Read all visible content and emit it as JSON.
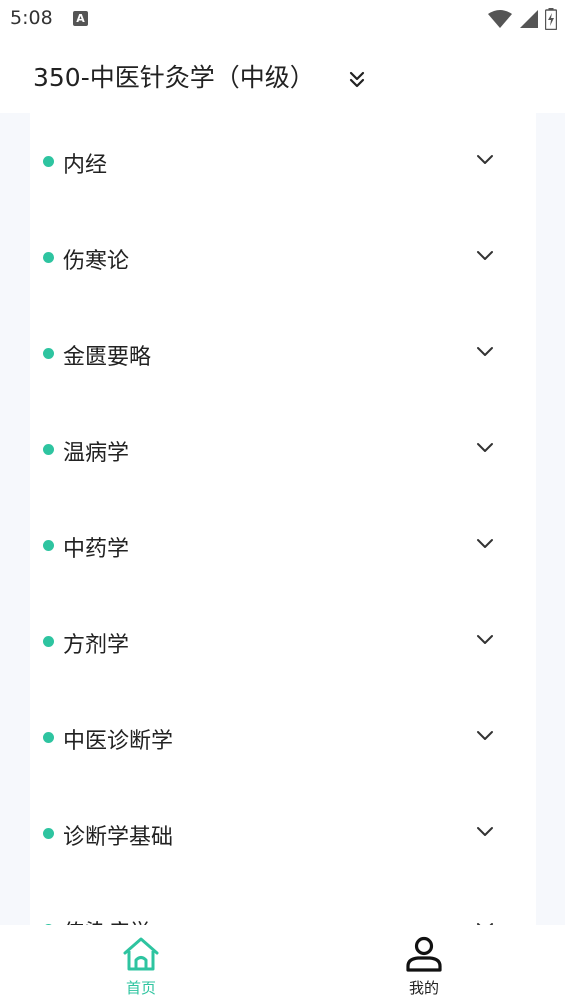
{
  "status_bar": {
    "time": "5:08",
    "notification_icon": "A"
  },
  "header": {
    "title": "350-中医针灸学（中级）",
    "toggle_icon": "double-chevron-down-icon"
  },
  "accent_color": "#2ec4a0",
  "subjects": [
    {
      "label": "内经"
    },
    {
      "label": "伤寒论"
    },
    {
      "label": "金匮要略"
    },
    {
      "label": "温病学"
    },
    {
      "label": "中药学"
    },
    {
      "label": "方剂学"
    },
    {
      "label": "中医诊断学"
    },
    {
      "label": "诊断学基础"
    },
    {
      "label": "传染病学"
    }
  ],
  "bottom_nav": {
    "home": {
      "label": "首页",
      "icon": "home-icon",
      "active": true
    },
    "mine": {
      "label": "我的",
      "icon": "person-icon",
      "active": false
    }
  }
}
